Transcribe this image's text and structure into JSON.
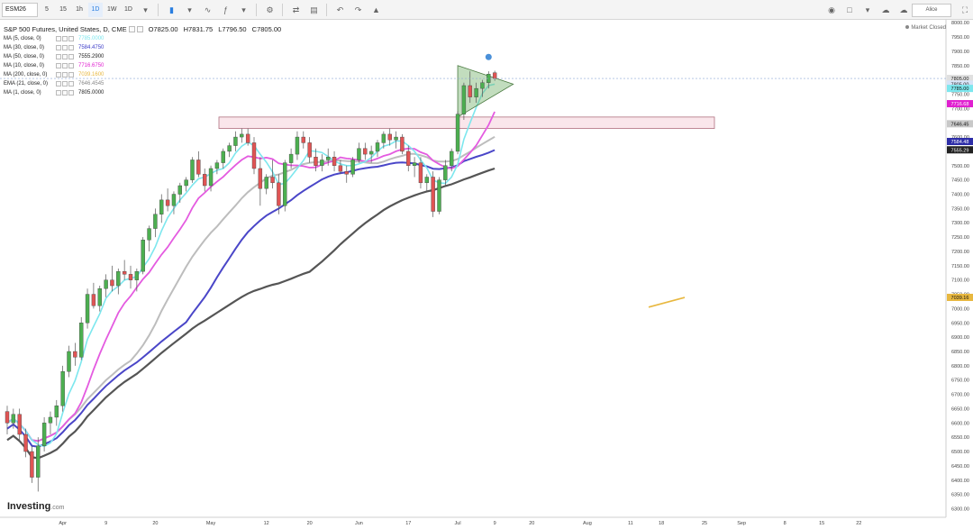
{
  "toolbar": {
    "symbol": "ESM26",
    "intervals": [
      "5",
      "15",
      "1h",
      "1D",
      "1W",
      "1D"
    ],
    "active_interval_index": 3,
    "account": "Alice"
  },
  "legend": {
    "title": "S&P 500 Futures, United States, D, CME",
    "ohlc": {
      "o": "O7825.00",
      "h": "H7831.75",
      "l": "L7796.50",
      "c": "C7805.00"
    },
    "indicators": [
      {
        "label": "MA (5, close, 0)",
        "value": "7785.0000",
        "color": "#7de7ee"
      },
      {
        "label": "MA (30, close, 0)",
        "value": "7584.4750",
        "color": "#3b3bc8"
      },
      {
        "label": "MA (50, close, 0)",
        "value": "7555.2900",
        "color": "#222222"
      },
      {
        "label": "MA (10, close, 0)",
        "value": "7716.6750",
        "color": "#e020d0"
      },
      {
        "label": "MA (200, close, 0)",
        "value": "7039.1600",
        "color": "#e8b840"
      },
      {
        "label": "EMA (21, close, 0)",
        "value": "7646.4545",
        "color": "#888888"
      },
      {
        "label": "MA (1, close, 0)",
        "value": "7805.0000",
        "color": "#222222"
      }
    ]
  },
  "status": {
    "market": "Market Closed"
  },
  "brand": {
    "name": "Investing",
    "suffix": ".com"
  },
  "price_tags": [
    {
      "text": "7805.00",
      "price": 7805,
      "bg": "#e0e0e0",
      "fg": "#222222"
    },
    {
      "text": "7805.00",
      "price": 7785,
      "bg": "#d8e4f8",
      "fg": "#222222",
      "label_price": 7785,
      "display_price": 7805
    },
    {
      "text": "7785.00",
      "price": 7770,
      "bg": "#7de7ee",
      "fg": "#111111"
    },
    {
      "text": "7716.68",
      "price": 7716.68,
      "bg": "#e020d0",
      "fg": "#ffffff"
    },
    {
      "text": "7646.45",
      "price": 7646.45,
      "bg": "#c8c8c8",
      "fg": "#111111"
    },
    {
      "text": "7584.48",
      "price": 7584.48,
      "bg": "#2e2ea8",
      "fg": "#ffffff"
    },
    {
      "text": "7555.29",
      "price": 7555.29,
      "bg": "#222222",
      "fg": "#ffffff"
    },
    {
      "text": "7039.16",
      "price": 7039.16,
      "bg": "#e8b840",
      "fg": "#111111"
    }
  ],
  "chart_data": {
    "type": "candlestick",
    "y_ticks": [
      6300,
      6350,
      6400,
      6450,
      6500,
      6550,
      6600,
      6650,
      6700,
      6750,
      6800,
      6850,
      6900,
      6950,
      7000,
      7050,
      7100,
      7150,
      7200,
      7250,
      7300,
      7350,
      7400,
      7450,
      7500,
      7550,
      7600,
      7650,
      7700,
      7750,
      7800,
      7850,
      7900,
      7950,
      8000
    ],
    "y_labels": [
      "6300.00",
      "6350.00",
      "6400.00",
      "6450.00",
      "6500.00",
      "6550.00",
      "6600.00",
      "6650.00",
      "6700.00",
      "6750.00",
      "6800.00",
      "6850.00",
      "6900.00",
      "6950.00",
      "7000.00",
      "7050.00",
      "7100.00",
      "7150.00",
      "7200.00",
      "7250.00",
      "7300.00",
      "7350.00",
      "7400.00",
      "7450.00",
      "7500.00",
      "7550.00",
      "7600.00",
      "7650.00",
      "7700.00",
      "7750.00",
      "7800.00",
      "7850.00",
      "7900.00",
      "7950.00",
      "8000.00"
    ],
    "ylim": [
      6270,
      8010
    ],
    "x_labels": [
      "Apr",
      "9",
      "20",
      "May",
      "12",
      "20",
      "Jun",
      "17",
      "Jul",
      "9",
      "20",
      "Aug",
      "11",
      "18",
      "25",
      "Sep",
      "8",
      "15",
      "22"
    ],
    "x_label_index": [
      9,
      16,
      24,
      33,
      42,
      49,
      57,
      65,
      73,
      79,
      85,
      94,
      101,
      106,
      113,
      119,
      126,
      132,
      138
    ],
    "candles": [
      [
        6640,
        6660,
        6560,
        6600
      ],
      [
        6600,
        6650,
        6580,
        6630
      ],
      [
        6630,
        6650,
        6540,
        6560
      ],
      [
        6560,
        6580,
        6480,
        6500
      ],
      [
        6500,
        6520,
        6390,
        6410
      ],
      [
        6410,
        6550,
        6360,
        6520
      ],
      [
        6520,
        6620,
        6500,
        6600
      ],
      [
        6600,
        6640,
        6560,
        6620
      ],
      [
        6620,
        6680,
        6590,
        6660
      ],
      [
        6660,
        6800,
        6640,
        6780
      ],
      [
        6780,
        6870,
        6760,
        6850
      ],
      [
        6850,
        6880,
        6800,
        6830
      ],
      [
        6830,
        6970,
        6820,
        6950
      ],
      [
        6950,
        7070,
        6930,
        7050
      ],
      [
        7050,
        7090,
        7000,
        7010
      ],
      [
        7010,
        7080,
        6990,
        7070
      ],
      [
        7070,
        7120,
        7040,
        7100
      ],
      [
        7100,
        7150,
        7060,
        7080
      ],
      [
        7080,
        7140,
        7050,
        7130
      ],
      [
        7130,
        7170,
        7100,
        7120
      ],
      [
        7120,
        7150,
        7070,
        7100
      ],
      [
        7100,
        7140,
        7060,
        7130
      ],
      [
        7130,
        7250,
        7120,
        7240
      ],
      [
        7240,
        7290,
        7200,
        7280
      ],
      [
        7280,
        7350,
        7250,
        7330
      ],
      [
        7330,
        7400,
        7300,
        7380
      ],
      [
        7380,
        7420,
        7340,
        7360
      ],
      [
        7360,
        7410,
        7330,
        7400
      ],
      [
        7400,
        7440,
        7370,
        7430
      ],
      [
        7430,
        7460,
        7410,
        7450
      ],
      [
        7450,
        7530,
        7440,
        7520
      ],
      [
        7520,
        7550,
        7460,
        7470
      ],
      [
        7470,
        7490,
        7410,
        7430
      ],
      [
        7430,
        7500,
        7410,
        7490
      ],
      [
        7490,
        7520,
        7470,
        7510
      ],
      [
        7510,
        7560,
        7490,
        7550
      ],
      [
        7550,
        7580,
        7530,
        7570
      ],
      [
        7570,
        7620,
        7550,
        7600
      ],
      [
        7600,
        7630,
        7580,
        7610
      ],
      [
        7610,
        7630,
        7570,
        7580
      ],
      [
        7580,
        7600,
        7470,
        7490
      ],
      [
        7490,
        7530,
        7360,
        7420
      ],
      [
        7420,
        7470,
        7400,
        7460
      ],
      [
        7460,
        7520,
        7420,
        7440
      ],
      [
        7440,
        7470,
        7330,
        7360
      ],
      [
        7360,
        7520,
        7340,
        7510
      ],
      [
        7510,
        7560,
        7490,
        7540
      ],
      [
        7540,
        7620,
        7520,
        7600
      ],
      [
        7600,
        7620,
        7560,
        7580
      ],
      [
        7580,
        7600,
        7510,
        7530
      ],
      [
        7530,
        7560,
        7480,
        7500
      ],
      [
        7500,
        7540,
        7480,
        7520
      ],
      [
        7520,
        7560,
        7500,
        7530
      ],
      [
        7530,
        7550,
        7480,
        7500
      ],
      [
        7500,
        7520,
        7470,
        7480
      ],
      [
        7480,
        7500,
        7440,
        7470
      ],
      [
        7470,
        7530,
        7460,
        7520
      ],
      [
        7520,
        7580,
        7510,
        7560
      ],
      [
        7560,
        7580,
        7520,
        7540
      ],
      [
        7540,
        7570,
        7510,
        7550
      ],
      [
        7550,
        7590,
        7530,
        7580
      ],
      [
        7580,
        7620,
        7560,
        7610
      ],
      [
        7610,
        7630,
        7570,
        7590
      ],
      [
        7590,
        7620,
        7560,
        7600
      ],
      [
        7600,
        7610,
        7540,
        7550
      ],
      [
        7550,
        7570,
        7480,
        7500
      ],
      [
        7500,
        7530,
        7460,
        7510
      ],
      [
        7510,
        7530,
        7420,
        7440
      ],
      [
        7440,
        7470,
        7410,
        7460
      ],
      [
        7460,
        7480,
        7320,
        7340
      ],
      [
        7340,
        7460,
        7330,
        7450
      ],
      [
        7450,
        7520,
        7430,
        7500
      ],
      [
        7500,
        7560,
        7480,
        7550
      ],
      [
        7550,
        7690,
        7540,
        7680
      ],
      [
        7680,
        7790,
        7660,
        7780
      ],
      [
        7780,
        7830,
        7720,
        7740
      ],
      [
        7740,
        7790,
        7720,
        7770
      ],
      [
        7770,
        7800,
        7740,
        7790
      ],
      [
        7790,
        7830,
        7770,
        7820
      ],
      [
        7825,
        7832,
        7797,
        7805
      ]
    ],
    "ma_series_note": ""
  }
}
